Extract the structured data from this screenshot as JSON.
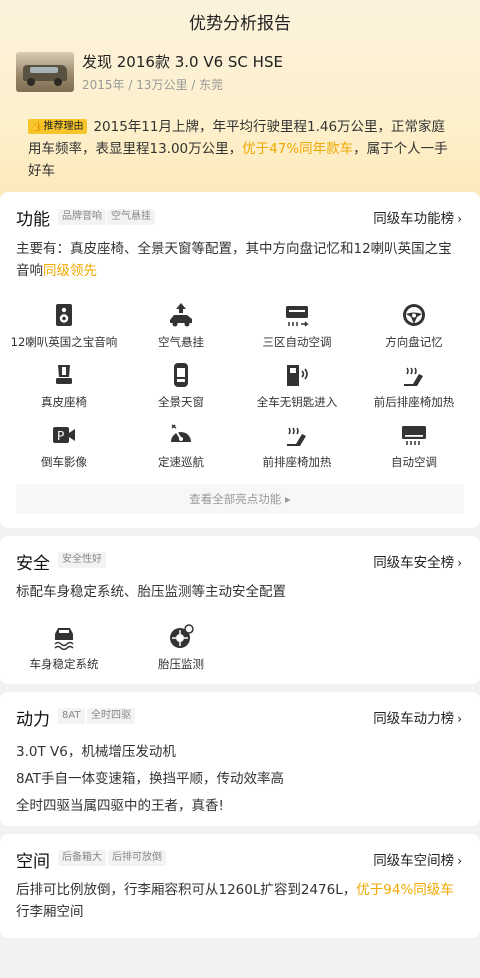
{
  "header": {
    "title": "优势分析报告"
  },
  "car": {
    "name": "发现 2016款 3.0 V6 SC HSE",
    "meta": "2015年 / 13万公里 / 东莞"
  },
  "reason": {
    "tag": "推荐理由",
    "text1": "2015年11月上牌，年平均行驶里程1.46万公里，正常家庭用车频率，表显里程13.00万公里，",
    "highlight": "优于47%同年款车",
    "text2": "，属于个人一手好车"
  },
  "function": {
    "title": "功能",
    "chips": [
      "品牌音响",
      "空气悬挂"
    ],
    "rank": "同级车功能榜",
    "desc": "主要有：真皮座椅、全景天窗等配置，其中方向盘记忆和12喇叭英国之宝音响",
    "desc_hl": "同级领先",
    "items": [
      {
        "label": "12喇叭英国之宝音响",
        "icon": "speaker-icon"
      },
      {
        "label": "空气悬挂",
        "icon": "air-suspension-icon"
      },
      {
        "label": "三区自动空调",
        "icon": "climate-icon"
      },
      {
        "label": "方向盘记忆",
        "icon": "steering-wheel-icon"
      },
      {
        "label": "真皮座椅",
        "icon": "seat-icon"
      },
      {
        "label": "全景天窗",
        "icon": "sunroof-icon"
      },
      {
        "label": "全车无钥匙进入",
        "icon": "keyless-icon"
      },
      {
        "label": "前后排座椅加热",
        "icon": "seat-heat-icon"
      },
      {
        "label": "倒车影像",
        "icon": "parking-camera-icon"
      },
      {
        "label": "定速巡航",
        "icon": "cruise-icon"
      },
      {
        "label": "前排座椅加热",
        "icon": "front-seat-heat-icon"
      },
      {
        "label": "自动空调",
        "icon": "auto-ac-icon"
      }
    ],
    "more": "查看全部亮点功能"
  },
  "safety": {
    "title": "安全",
    "chips": [
      "安全性好"
    ],
    "rank": "同级车安全榜",
    "desc": "标配车身稳定系统、胎压监测等主动安全配置",
    "items": [
      {
        "label": "车身稳定系统",
        "icon": "stability-icon"
      },
      {
        "label": "胎压监测",
        "icon": "tire-pressure-icon"
      }
    ]
  },
  "power": {
    "title": "动力",
    "chips": [
      "8AT",
      "全时四驱"
    ],
    "rank": "同级车动力榜",
    "lines": [
      "3.0T V6，机械增压发动机",
      "8AT手自一体变速箱，换挡平顺，传动效率高",
      "全时四驱当属四驱中的王者，真香!"
    ]
  },
  "space": {
    "title": "空间",
    "chips": [
      "后备箱大",
      "后排可放倒"
    ],
    "rank": "同级车空间榜",
    "desc": "后排可比例放倒，行李厢容积可从1260L扩容到2476L，",
    "desc_hl": "优于94%同级车",
    "desc2": "行李厢空间"
  },
  "colors": {
    "accent": "#f0a800",
    "tag": "#f7c42b"
  }
}
